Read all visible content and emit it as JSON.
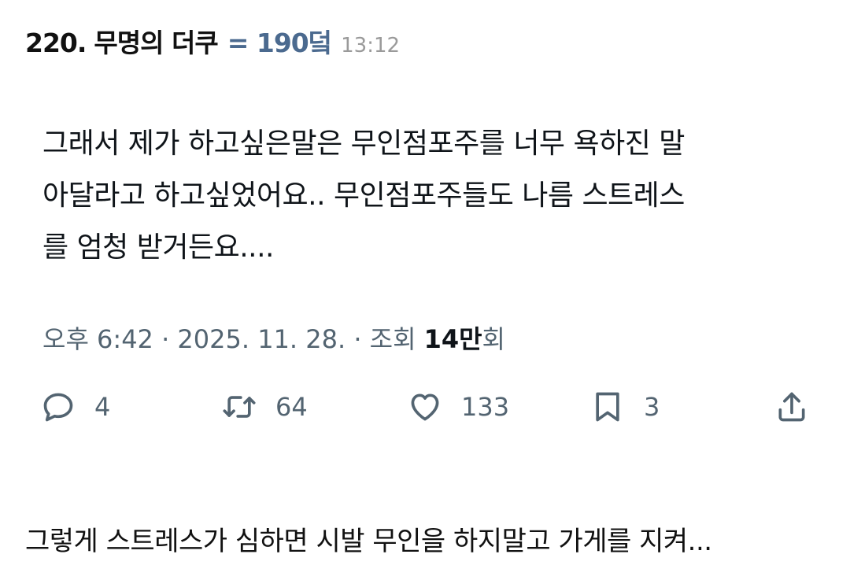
{
  "header": {
    "number": "220.",
    "author": "무명의 더쿠",
    "score": "= 190덬",
    "time": "13:12"
  },
  "tweet": {
    "lines": [
      "그래서 제가 하고싶은말은 무인점포주를 너무 욕하진 말",
      "아달라고 하고싶었어요.. 무인점포주들도 나름 스트레스",
      "를 엄청 받거든요...."
    ],
    "meta": {
      "time_date": "오후 6:42 · 2025. 11. 28. · 조회",
      "views_count": "14만",
      "views_unit": "회"
    }
  },
  "actions": {
    "reply": {
      "icon": "reply-icon",
      "count": "4"
    },
    "retweet": {
      "icon": "retweet-icon",
      "count": "64"
    },
    "like": {
      "icon": "heart-icon",
      "count": "133"
    },
    "bookmark": {
      "icon": "bookmark-icon",
      "count": "3"
    },
    "share": {
      "icon": "share-icon"
    }
  },
  "comment": {
    "text": "그렇게 스트레스가 심하면 시발 무인을 하지말고 가게를 지켜..."
  },
  "colors": {
    "score": "#4b6a8f",
    "muted": "#536471",
    "text": "#0f1419"
  }
}
